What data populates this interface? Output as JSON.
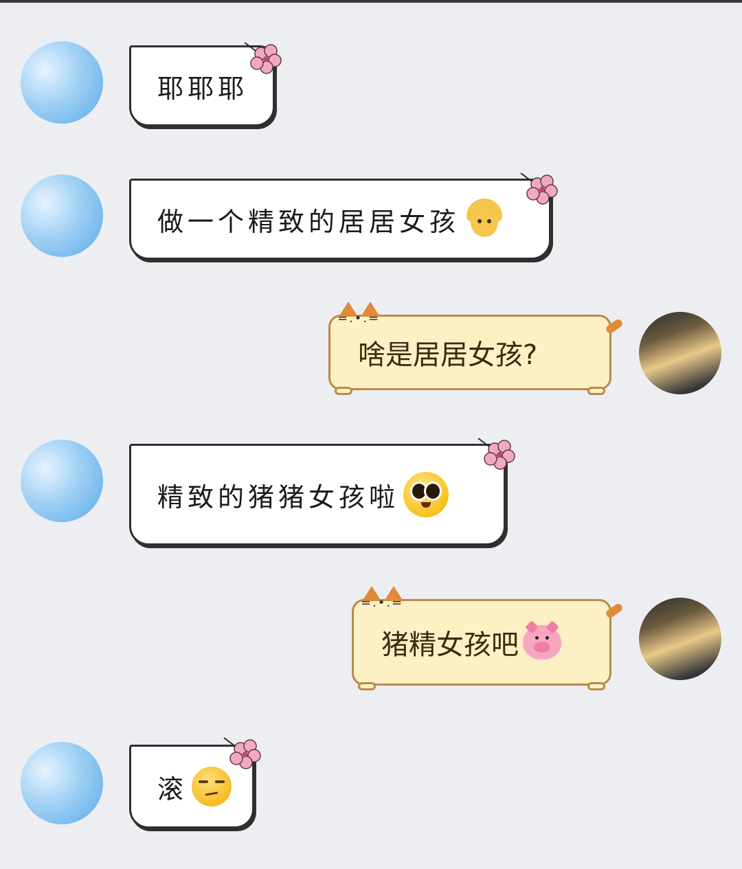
{
  "messages": [
    {
      "side": "left",
      "text": "耶耶耶",
      "emoji": ""
    },
    {
      "side": "left",
      "text": "做一个精致的居居女孩",
      "emoji": "girl-emoji"
    },
    {
      "side": "right",
      "text": "啥是居居女孩?",
      "emoji": ""
    },
    {
      "side": "left",
      "text": "精致的猪猪女孩啦",
      "emoji": "pleading-face-emoji"
    },
    {
      "side": "right",
      "text": "猪精女孩吧",
      "emoji": "pig-face-emoji"
    },
    {
      "side": "left",
      "text": "滚",
      "emoji": "unamused-face-emoji"
    }
  ],
  "colors": {
    "background": "#edeef2",
    "left_bubble": "#ffffff",
    "right_bubble": "#fdf0c4",
    "right_border": "#b98a4a"
  }
}
